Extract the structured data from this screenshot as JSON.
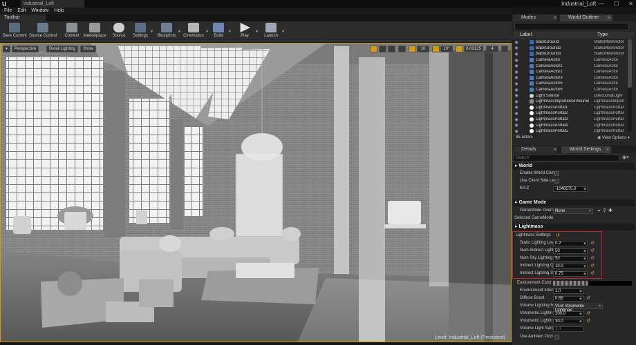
{
  "window": {
    "doc_tab": "Industrial_Loft",
    "project_name": "Industrial_Loft",
    "min": "—",
    "max": "☐",
    "close": "✕"
  },
  "menu": [
    "File",
    "Edit",
    "Window",
    "Help"
  ],
  "toolbar": {
    "tab_label": "Toolbar",
    "buttons": [
      "Save Current",
      "Source Control",
      "Content",
      "Marketplace",
      "Source",
      "Settings",
      "Blueprints",
      "Cinematics",
      "Build",
      "Play",
      "Launch"
    ]
  },
  "viewport": {
    "perspective": "Perspective",
    "lighting": "Detail Lighting",
    "show": "Show",
    "grid_size": "10",
    "rotation_snap": "10°",
    "scale_snap": "0.03125",
    "camera_speed": "4",
    "level_label": "Level:  Industrial_Loft (Persistent)"
  },
  "outliner": {
    "tabs": [
      "Modes",
      "World Outliner"
    ],
    "col_label": "Label",
    "col_type": "Type",
    "rows": [
      {
        "label": "BackGround",
        "type": "StaticMeshActor"
      },
      {
        "label": "BackGround2",
        "type": "StaticMeshActor"
      },
      {
        "label": "BackGround3",
        "type": "StaticMeshActor"
      },
      {
        "label": "CameraActor",
        "type": "CameraActor"
      },
      {
        "label": "CameraActor1",
        "type": "CameraActor"
      },
      {
        "label": "CameraActor2",
        "type": "CameraActor"
      },
      {
        "label": "CameraActor3",
        "type": "CameraActor"
      },
      {
        "label": "CameraActor5",
        "type": "CameraActor"
      },
      {
        "label": "CameraActor6",
        "type": "CameraActor"
      },
      {
        "label": "Light Source",
        "type": "DirectionalLight"
      },
      {
        "label": "LightmassImportanceVolume",
        "type": "LightmassImport"
      },
      {
        "label": "LightmassPortal1",
        "type": "LightmassPortal"
      },
      {
        "label": "LightmassPortal2",
        "type": "LightmassPortal"
      },
      {
        "label": "LightmassPortal3",
        "type": "LightmassPortal"
      },
      {
        "label": "LightmassPortal4",
        "type": "LightmassPortal"
      },
      {
        "label": "LightmassPortal5",
        "type": "LightmassPortal"
      }
    ],
    "count": "85 actors",
    "view_options": "View Options"
  },
  "details": {
    "tabs": [
      "Details",
      "World Settings"
    ],
    "search_placeholder": "Search",
    "cat_world": "World",
    "enable_world_compo": "Enable World Compo",
    "use_client_side": "Use Client Side Level",
    "kill_z_label": "Kill Z",
    "kill_z_value": "-1048575.0",
    "cat_game_mode": "Game Mode",
    "gamemode_override_label": "GameMode Override",
    "gamemode_override_value": "None",
    "selected_gamemode": "Selected GameMode",
    "cat_lightmass": "Lightmass",
    "lightmass_settings": "Lightmass Settings",
    "props": [
      {
        "label": "Static Lighting Lev",
        "value": "0.2"
      },
      {
        "label": "Num Indirect Lighti",
        "value": "50"
      },
      {
        "label": "Num Sky Lighting B",
        "value": "50"
      },
      {
        "label": "Indirect Lighting Q",
        "value": "10.0"
      },
      {
        "label": "Indirect Lighting Sr",
        "value": "0.75"
      }
    ],
    "environment_color": "Environment Color",
    "env_intensity_label": "Environment Intens",
    "env_intensity_value": "1.0",
    "diffuse_boost_label": "Diffuse Boost",
    "diffuse_boost_value": "0.65",
    "vol_method_label": "Volume Lighting M",
    "vol_method_value": "VLM Volumetric Lightmap",
    "vol_detail1_label": "Volumetric Lightin",
    "vol_detail1_value": "200.0",
    "vol_detail2_label": "Volumetric Lightin",
    "vol_detail2_value": "30.0",
    "vol_sample_label": "Volume Light Samp",
    "vol_sample_value": "1.0",
    "ambient_occlu": "Use Ambient Occlu"
  },
  "colors": {
    "accent": "#d39b10",
    "highlight": "#c0262c"
  }
}
